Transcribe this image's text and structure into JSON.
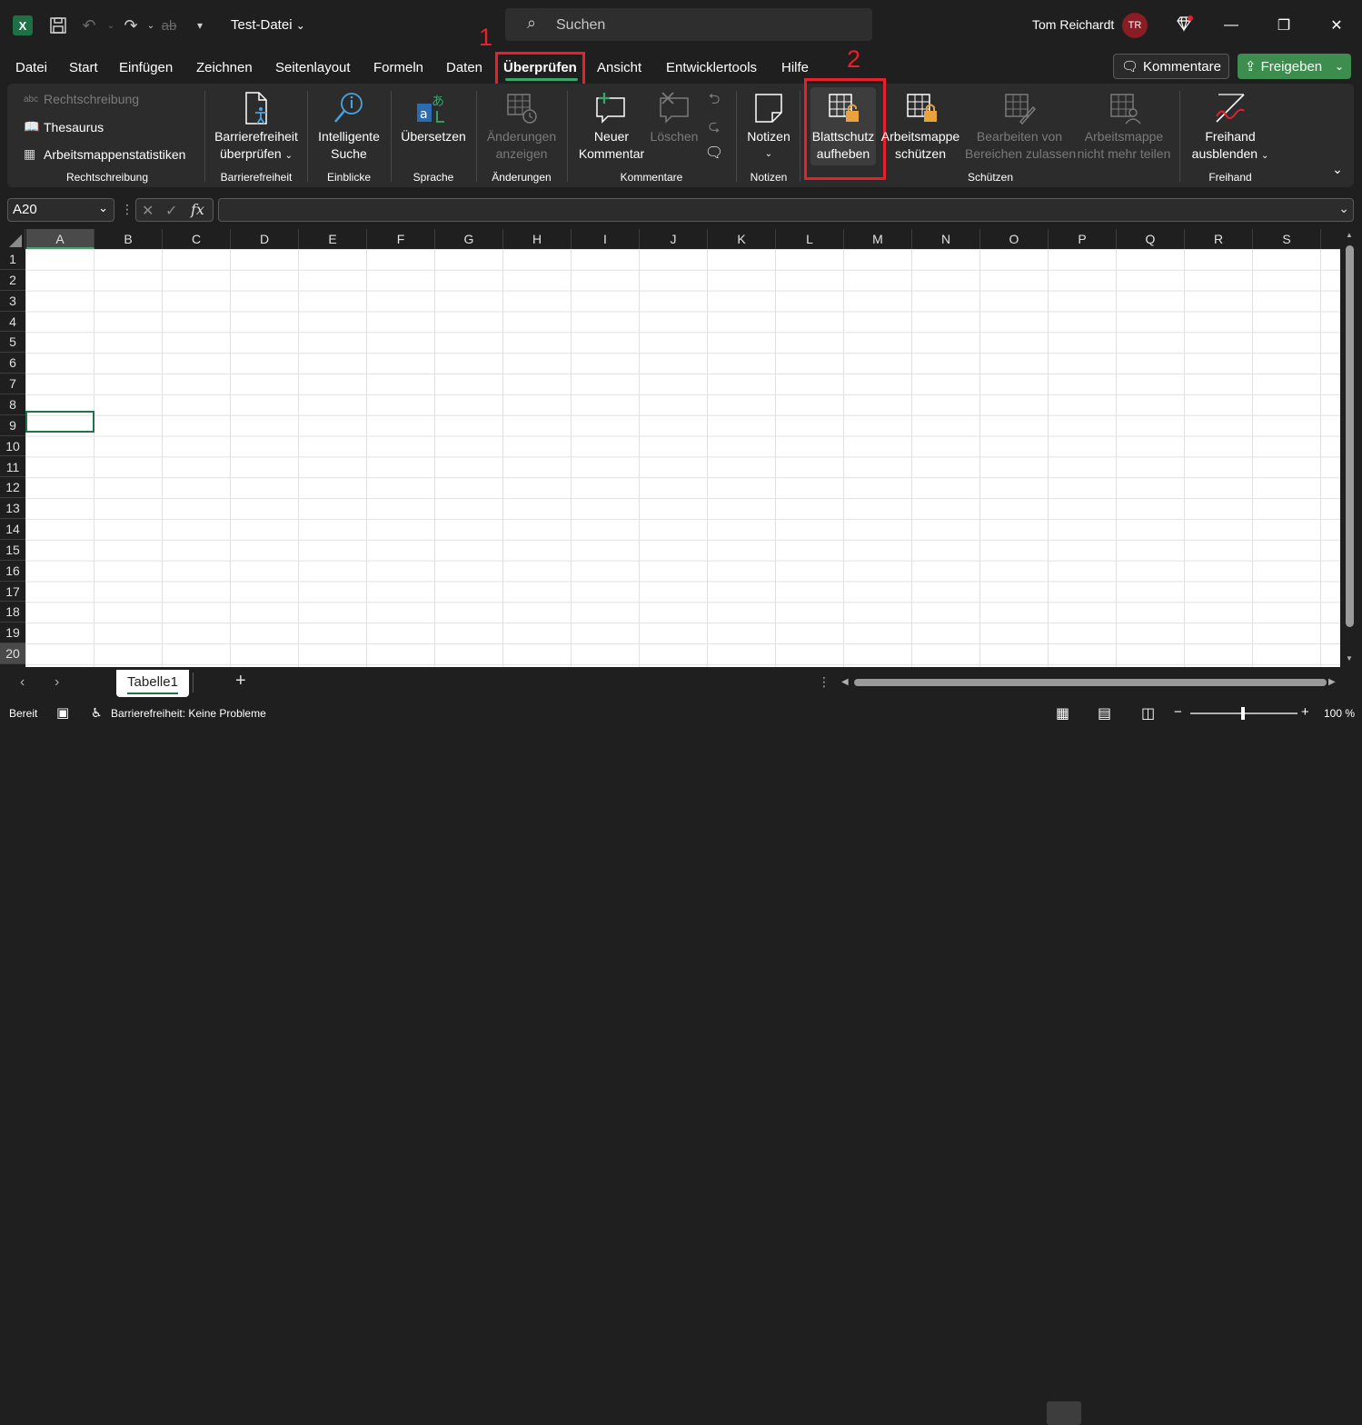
{
  "titlebar": {
    "logo": "X",
    "filename": "Test-Datei",
    "search_placeholder": "Suchen",
    "username": "Tom Reichardt",
    "avatar_initials": "TR"
  },
  "menu": {
    "items": [
      "Datei",
      "Start",
      "Einfügen",
      "Zeichnen",
      "Seitenlayout",
      "Formeln",
      "Daten",
      "Überprüfen",
      "Ansicht",
      "Entwicklertools",
      "Hilfe"
    ],
    "active": "Überprüfen",
    "kommentare_label": "Kommentare",
    "freigeben_label": "Freigeben"
  },
  "annotations": {
    "step1": "1",
    "step2": "2",
    "color": "#e8202b"
  },
  "ribbon": {
    "rechtschreibung": {
      "spelling": "Rechtschreibung",
      "thesaurus": "Thesaurus",
      "stats": "Arbeitsmappenstatistiken",
      "group": "Rechtschreibung"
    },
    "barrierefreiheit": {
      "line1": "Barrierefreiheit",
      "line2": "überprüfen",
      "group": "Barrierefreiheit"
    },
    "einblicke": {
      "line1": "Intelligente",
      "line2": "Suche",
      "group": "Einblicke"
    },
    "sprache": {
      "line1": "Übersetzen",
      "group": "Sprache"
    },
    "aenderungen": {
      "line1": "Änderungen",
      "line2": "anzeigen",
      "group": "Änderungen"
    },
    "kommentare": {
      "neu1": "Neuer",
      "neu2": "Kommentar",
      "loeschen": "Löschen",
      "group": "Kommentare"
    },
    "notizen": {
      "line1": "Notizen",
      "group": "Notizen"
    },
    "schuetzen": {
      "blatt1": "Blattschutz",
      "blatt2": "aufheben",
      "mappe1": "Arbeitsmappe",
      "mappe2": "schützen",
      "bereich1": "Bearbeiten von",
      "bereich2": "Bereichen zulassen",
      "teilen1": "Arbeitsmappe",
      "teilen2": "nicht mehr teilen",
      "group": "Schützen"
    },
    "freihand": {
      "line1": "Freihand",
      "line2": "ausblenden",
      "group": "Freihand"
    }
  },
  "formula_bar": {
    "namebox": "A20",
    "fx": "fx"
  },
  "grid": {
    "columns": [
      "A",
      "B",
      "C",
      "D",
      "E",
      "F",
      "G",
      "H",
      "I",
      "J",
      "K",
      "L",
      "M",
      "N",
      "O",
      "P",
      "Q",
      "R",
      "S"
    ],
    "rows": [
      "1",
      "2",
      "3",
      "4",
      "5",
      "6",
      "7",
      "8",
      "9",
      "10",
      "11",
      "12",
      "13",
      "14",
      "15",
      "16",
      "17",
      "18",
      "19",
      "20"
    ],
    "active_cell": "A20"
  },
  "sheets": {
    "tabs": [
      "Tabelle1"
    ],
    "active": "Tabelle1",
    "add": "+"
  },
  "status": {
    "ready": "Bereit",
    "accessibility": "Barrierefreiheit: Keine Probleme",
    "zoom": "100 %",
    "zoom_level_percent": 100
  }
}
